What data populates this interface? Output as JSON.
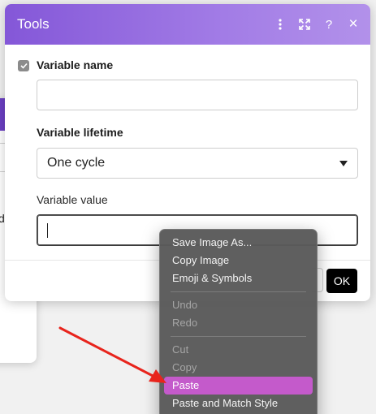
{
  "dialog": {
    "title": "Tools",
    "icons": [
      "more-vertical-icon",
      "expand-icon",
      "help-icon",
      "close-icon"
    ],
    "help_glyph": "?",
    "close_glyph": "×"
  },
  "back_dialog": {
    "help_glyph": "?",
    "close_glyph": "×",
    "partial_text": "d"
  },
  "form": {
    "variable_name_label": "Variable name",
    "variable_name_value": "",
    "variable_lifetime_label": "Variable lifetime",
    "variable_lifetime_value": "One cycle",
    "variable_value_label": "Variable value",
    "variable_value_value": ""
  },
  "footer": {
    "ok_label": "OK"
  },
  "context_menu": {
    "groups": [
      [
        {
          "label": "Save Image As...",
          "enabled": true
        },
        {
          "label": "Copy Image",
          "enabled": true
        },
        {
          "label": "Emoji & Symbols",
          "enabled": true
        }
      ],
      [
        {
          "label": "Undo",
          "enabled": false
        },
        {
          "label": "Redo",
          "enabled": false
        }
      ],
      [
        {
          "label": "Cut",
          "enabled": false
        },
        {
          "label": "Copy",
          "enabled": false
        },
        {
          "label": "Paste",
          "enabled": true,
          "highlighted": true
        },
        {
          "label": "Paste and Match Style",
          "enabled": true
        }
      ]
    ]
  },
  "colors": {
    "header_purple": "#8457d8",
    "highlight_magenta": "#c45acb",
    "annotation_red": "#e8241c"
  }
}
